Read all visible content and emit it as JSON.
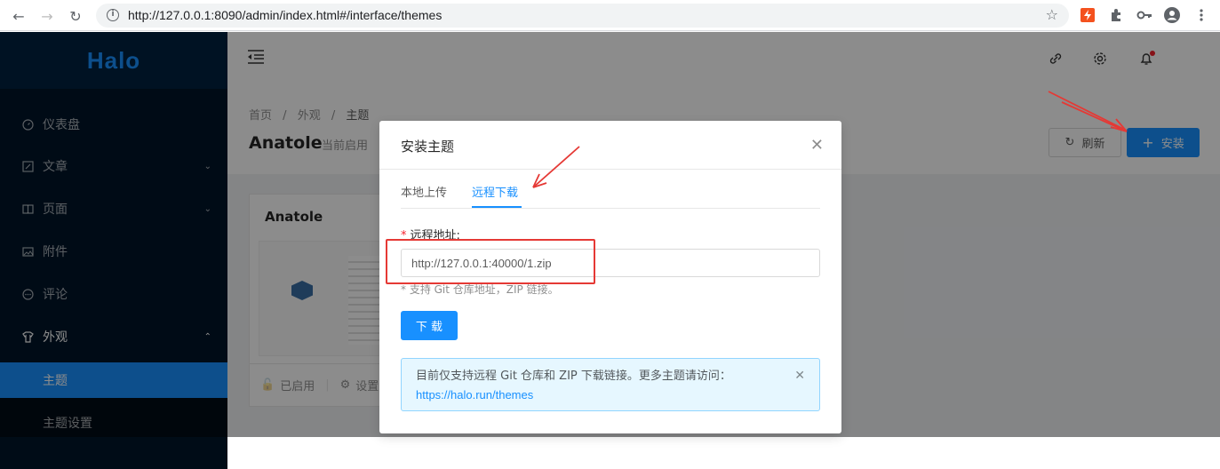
{
  "browser": {
    "url": "http://127.0.0.1:8090/admin/index.html#/interface/themes",
    "back_icon": "←",
    "forward_icon": "→",
    "reload_icon": "↻",
    "info_icon": "i",
    "star_icon": "☆"
  },
  "sidebar": {
    "logo": "Halo",
    "items": [
      {
        "label": "仪表盘",
        "icon": "dashboard-icon"
      },
      {
        "label": "文章",
        "icon": "form-icon"
      },
      {
        "label": "页面",
        "icon": "read-icon"
      },
      {
        "label": "附件",
        "icon": "picture-icon"
      },
      {
        "label": "评论",
        "icon": "comment-icon"
      },
      {
        "label": "外观",
        "icon": "skin-icon"
      },
      {
        "label": "主题"
      },
      {
        "label": "主题设置"
      }
    ]
  },
  "page": {
    "breadcrumb": [
      "首页",
      "外观",
      "主题"
    ],
    "title": "Anatole",
    "subtitle": "当前启用",
    "refresh_label": "刷新",
    "install_label": "安装"
  },
  "card": {
    "title": "Anatole",
    "enabled_label": "已启用",
    "settings_label": "设置"
  },
  "modal": {
    "title": "安装主题",
    "tabs": [
      "本地上传",
      "远程下载"
    ],
    "active_tab": "远程下载",
    "field_label": "远程地址:",
    "field_value": "http://127.0.0.1:40000/1.zip",
    "field_help": "* 支持 Git 仓库地址，ZIP 链接。",
    "download_label": "下 载",
    "alert_text": "目前仅支持远程 Git 仓库和 ZIP 下载链接。更多主题请访问：",
    "alert_link": "https://halo.run/themes"
  },
  "colors": {
    "primary": "#1890ff",
    "sidebar_bg": "#001529",
    "annotation": "#e53935"
  }
}
